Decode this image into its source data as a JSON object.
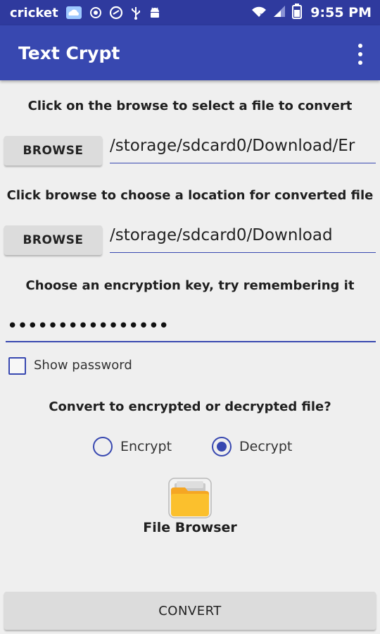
{
  "status_bar": {
    "carrier": "cricket",
    "time": "9:55 PM",
    "icons": [
      "cloud-icon",
      "circle-icon",
      "shield-icon",
      "usb-icon",
      "android-icon",
      "wifi-icon",
      "signal-icon",
      "battery-icon"
    ]
  },
  "app_bar": {
    "title": "Text Crypt",
    "menu_icon": "more-vert-icon"
  },
  "colors": {
    "primary": "#3848b0",
    "primary_dark": "#2f3a9e",
    "background": "#efefef",
    "button": "#dcdcdc",
    "folder": "#f7a81b"
  },
  "main": {
    "select_instruction": "Click on the browse to select a file to convert",
    "browse_label_1": "BROWSE",
    "source_path": "/storage/sdcard0/Download/Er",
    "location_instruction": "Click browse to choose a location for converted file",
    "browse_label_2": "BROWSE",
    "dest_path": "/storage/sdcard0/Download",
    "key_instruction": "Choose an encryption key, try remembering it",
    "password_value": "••••••••••••••••",
    "show_password_label": "Show password",
    "show_password_checked": false,
    "mode_question": "Convert to encrypted or decrypted file?",
    "mode_options": [
      {
        "label": "Encrypt",
        "selected": false
      },
      {
        "label": "Decrypt",
        "selected": true
      }
    ],
    "file_browser_label": "File Browser",
    "convert_label": "CONVERT"
  }
}
